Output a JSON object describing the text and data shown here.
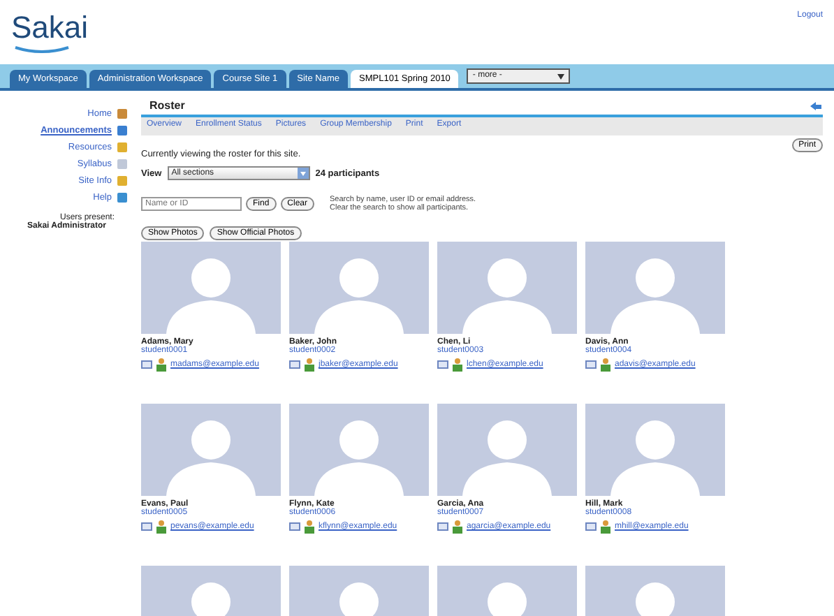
{
  "header": {
    "logo": "Sakai",
    "logout": "Logout"
  },
  "tabs": [
    {
      "label": "My Workspace",
      "selected": false
    },
    {
      "label": "Administration Workspace",
      "selected": false
    },
    {
      "label": "Course Site 1",
      "selected": false
    },
    {
      "label": "Site Name",
      "selected": false
    },
    {
      "label": "SMPL101 Spring 2010",
      "selected": true
    }
  ],
  "more_sites": "- more -",
  "sidebar": {
    "items": [
      {
        "label": "Home",
        "selected": false
      },
      {
        "label": "Announcements",
        "selected": true
      },
      {
        "label": "Resources",
        "selected": false
      },
      {
        "label": "Syllabus",
        "selected": false
      },
      {
        "label": "Site Info",
        "selected": false
      },
      {
        "label": "Help",
        "selected": false
      }
    ],
    "presence_title": "Users present:",
    "presence_user": "Sakai Administrator"
  },
  "tool": {
    "title": "Roster",
    "nav": [
      "Overview",
      "Enrollment Status",
      "Pictures",
      "Group Membership",
      "Print",
      "Export"
    ],
    "print_button": "Print",
    "intro": "Currently viewing the roster for this site.",
    "view_label": "View",
    "view_value": "All sections",
    "count": "24 participants",
    "search_placeholder": "Name or ID",
    "find_button": "Find",
    "clear_button": "Clear",
    "hint_lines": [
      "Search by name, user ID or email address.",
      "Clear the search to show all participants."
    ],
    "photo_buttons": [
      "Show Photos",
      "Show Official Photos"
    ]
  },
  "participants": [
    {
      "kind": "participant",
      "name": "Adams, Mary",
      "id": "student0001",
      "email": "madams@example.edu"
    },
    {
      "kind": "participant",
      "name": "Baker, John",
      "id": "student0002",
      "email": "jbaker@example.edu"
    },
    {
      "kind": "participant",
      "name": "Chen, Li",
      "id": "student0003",
      "email": "lchen@example.edu"
    },
    {
      "kind": "participant",
      "name": "Davis, Ann",
      "id": "student0004",
      "email": "adavis@example.edu"
    },
    {
      "kind": "participant",
      "name": "Evans, Paul",
      "id": "student0005",
      "email": "pevans@example.edu"
    },
    {
      "kind": "participant",
      "name": "Flynn, Kate",
      "id": "student0006",
      "email": "kflynn@example.edu"
    },
    {
      "kind": "participant",
      "name": "Garcia, Ana",
      "id": "student0007",
      "email": "agarcia@example.edu"
    },
    {
      "kind": "participant",
      "name": "Hill, Mark",
      "id": "student0008",
      "email": "mhill@example.edu"
    },
    {
      "kind": "photo-only"
    },
    {
      "kind": "photo-only"
    },
    {
      "kind": "photo-only"
    },
    {
      "kind": "photo-only"
    }
  ]
}
